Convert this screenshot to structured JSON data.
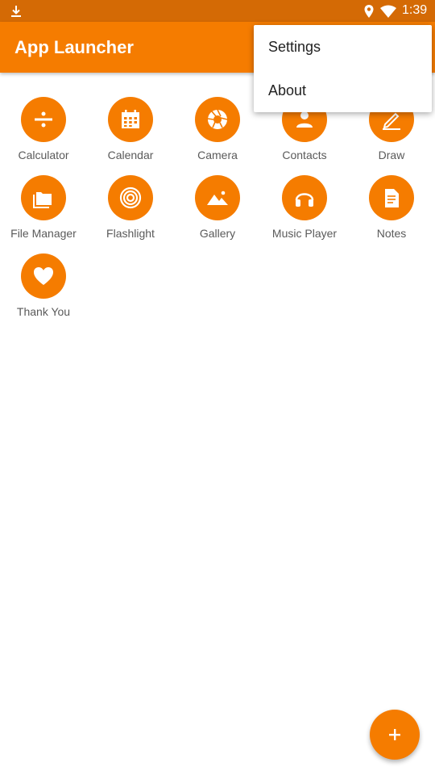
{
  "status_bar": {
    "time": "1:39",
    "icons": [
      "download-icon",
      "location-icon",
      "wifi-icon"
    ]
  },
  "app_bar": {
    "title": "App Launcher"
  },
  "menu": {
    "items": [
      {
        "label": "Settings"
      },
      {
        "label": "About"
      }
    ]
  },
  "apps": [
    {
      "label": "Calculator",
      "icon": "calculator-icon"
    },
    {
      "label": "Calendar",
      "icon": "calendar-icon"
    },
    {
      "label": "Camera",
      "icon": "camera-icon"
    },
    {
      "label": "Contacts",
      "icon": "contacts-icon"
    },
    {
      "label": "Draw",
      "icon": "draw-icon"
    },
    {
      "label": "File Manager",
      "icon": "folder-icon"
    },
    {
      "label": "Flashlight",
      "icon": "flashlight-icon"
    },
    {
      "label": "Gallery",
      "icon": "gallery-icon"
    },
    {
      "label": "Music Player",
      "icon": "headphones-icon"
    },
    {
      "label": "Notes",
      "icon": "notes-icon"
    },
    {
      "label": "Thank You",
      "icon": "heart-icon"
    }
  ],
  "fab": {
    "icon": "plus-icon"
  },
  "colors": {
    "primary": "#f57c00",
    "status_bar": "#d46a05",
    "label_text": "#5a5a5a"
  }
}
